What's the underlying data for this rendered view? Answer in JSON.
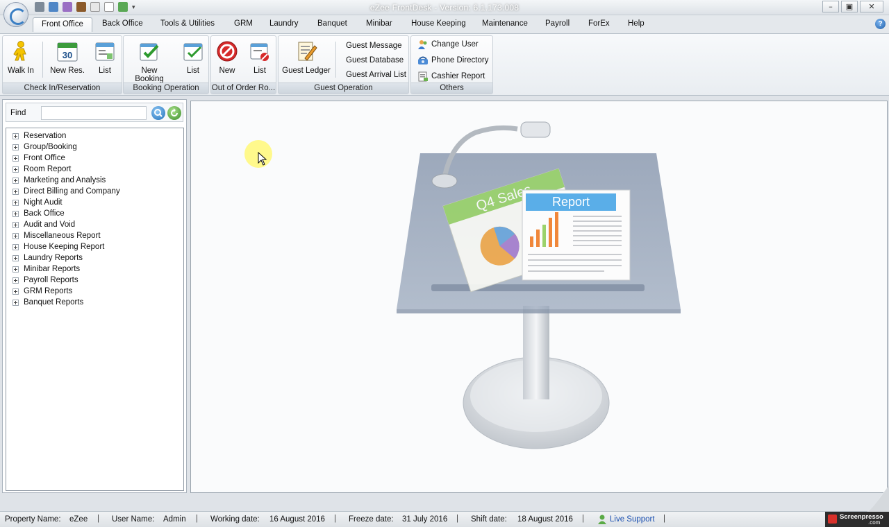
{
  "window": {
    "title": "eZee FrontDesk - Version: 6.1.173.008",
    "controls": {
      "minimize": "–",
      "restore": "▣",
      "close": "✕"
    }
  },
  "tabs": [
    "Front Office",
    "Back Office",
    "Tools & Utilities",
    "GRM",
    "Laundry",
    "Banquet",
    "Minibar",
    "House Keeping",
    "Maintenance",
    "Payroll",
    "ForEx",
    "Help"
  ],
  "ribbon": {
    "check_in": {
      "label": "Check In/Reservation",
      "walk_in": "Walk In",
      "new_res": "New Res.",
      "list": "List",
      "calendar_day": "30"
    },
    "booking": {
      "label": "Booking Operation",
      "new_booking": "New Booking",
      "list": "List"
    },
    "out_of_order": {
      "label": "Out of Order Ro...",
      "new": "New",
      "list": "List"
    },
    "guest_op": {
      "label": "Guest Operation",
      "guest_ledger": "Guest Ledger",
      "guest_message": "Guest Message",
      "guest_database": "Guest Database",
      "guest_arrival_list": "Guest Arrival List"
    },
    "others": {
      "label": "Others",
      "change_user": "Change User",
      "phone_directory": "Phone Directory",
      "cashier_report": "Cashier Report"
    }
  },
  "find": {
    "label": "Find",
    "value": ""
  },
  "tree": {
    "items": [
      "Reservation",
      "Group/Booking",
      "Front Office",
      "Room Report",
      "Marketing and Analysis",
      "Direct Billing and Company",
      "Night Audit",
      "Back Office",
      "Audit and Void",
      "Miscellaneous Report",
      "House Keeping Report",
      "Laundry Reports",
      "Minibar Reports",
      "Payroll Reports",
      "GRM Reports",
      "Banquet Reports"
    ]
  },
  "illustration": {
    "sheet1": "Q4 Sales",
    "sheet2": "Report"
  },
  "status": {
    "property_label": "Property Name:",
    "property_value": "eZee",
    "user_label": "User Name:",
    "user_value": "Admin",
    "working_label": "Working date:",
    "working_value": "16 August 2016",
    "freeze_label": "Freeze date:",
    "freeze_value": "31 July 2016",
    "shift_label": "Shift date:",
    "shift_value": "18 August 2016",
    "live_support": "Live Support",
    "separator": "|"
  },
  "watermark": {
    "name": "Screenpresso",
    "suffix": ".com"
  }
}
